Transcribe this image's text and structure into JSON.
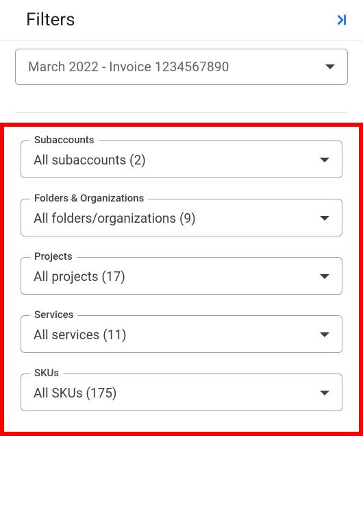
{
  "header": {
    "title": "Filters"
  },
  "invoice_dropdown": {
    "value": "March 2022 - Invoice 1234567890"
  },
  "filters": [
    {
      "label": "Subaccounts",
      "value": "All subaccounts (2)"
    },
    {
      "label": "Folders & Organizations",
      "value": "All folders/organizations (9)"
    },
    {
      "label": "Projects",
      "value": "All projects (17)"
    },
    {
      "label": "Services",
      "value": "All services (11)"
    },
    {
      "label": "SKUs",
      "value": "All SKUs (175)"
    }
  ]
}
